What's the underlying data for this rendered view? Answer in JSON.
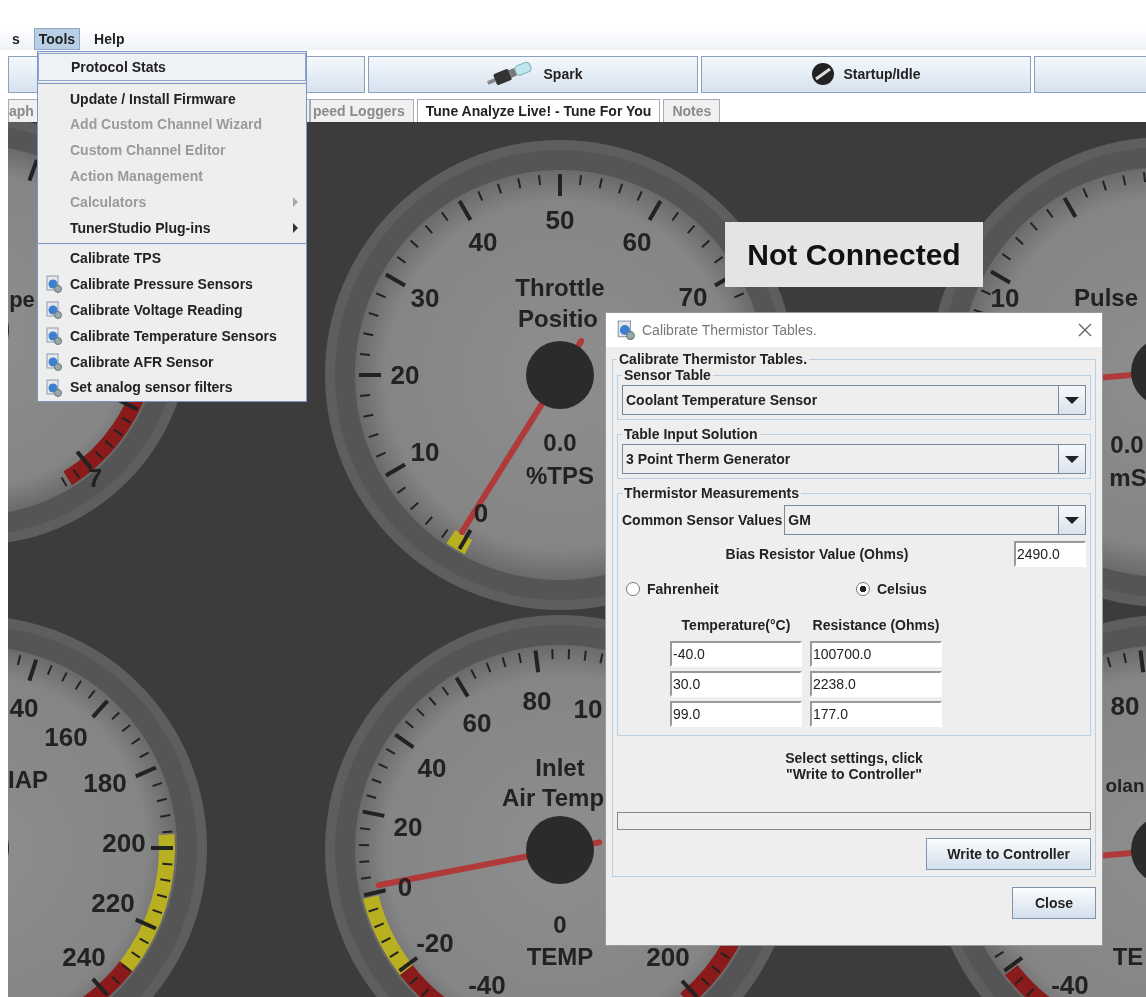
{
  "menubar": {
    "items": [
      {
        "label": "s",
        "selected": false
      },
      {
        "label": "Tools",
        "selected": true
      },
      {
        "label": "Help",
        "selected": false
      }
    ]
  },
  "tools_menu": {
    "items": [
      {
        "kind": "item",
        "label": "Protocol Stats",
        "selected": true,
        "disabled": false,
        "submenu": false,
        "icon": false
      },
      {
        "kind": "separator"
      },
      {
        "kind": "item",
        "label": "Update / Install Firmware",
        "selected": false,
        "disabled": false,
        "submenu": false,
        "icon": false
      },
      {
        "kind": "item",
        "label": "Add Custom Channel Wizard",
        "selected": false,
        "disabled": true,
        "submenu": false,
        "icon": false
      },
      {
        "kind": "item",
        "label": "Custom Channel Editor",
        "selected": false,
        "disabled": true,
        "submenu": false,
        "icon": false
      },
      {
        "kind": "item",
        "label": "Action Management",
        "selected": false,
        "disabled": true,
        "submenu": false,
        "icon": false
      },
      {
        "kind": "item",
        "label": "Calculators",
        "selected": false,
        "disabled": true,
        "submenu": true,
        "icon": false
      },
      {
        "kind": "item",
        "label": "TunerStudio Plug-ins",
        "selected": false,
        "disabled": false,
        "submenu": true,
        "icon": false
      },
      {
        "kind": "separator"
      },
      {
        "kind": "item",
        "label": "Calibrate TPS",
        "selected": false,
        "disabled": false,
        "submenu": false,
        "icon": false
      },
      {
        "kind": "item",
        "label": "Calibrate Pressure Sensors",
        "selected": false,
        "disabled": false,
        "submenu": false,
        "icon": true
      },
      {
        "kind": "item",
        "label": "Calibrate Voltage Reading",
        "selected": false,
        "disabled": false,
        "submenu": false,
        "icon": true
      },
      {
        "kind": "item",
        "label": "Calibrate Temperature Sensors",
        "selected": false,
        "disabled": false,
        "submenu": false,
        "icon": true
      },
      {
        "kind": "item",
        "label": "Calibrate AFR Sensor",
        "selected": false,
        "disabled": false,
        "submenu": false,
        "icon": true
      },
      {
        "kind": "item",
        "label": "Set analog sensor filters",
        "selected": false,
        "disabled": false,
        "submenu": false,
        "icon": true
      }
    ]
  },
  "toolbar": {
    "buttons": [
      {
        "label": "Spark"
      },
      {
        "label": "Startup/Idle"
      }
    ]
  },
  "tabs": [
    {
      "label": "aph",
      "selected": false
    },
    {
      "label": "peed Loggers",
      "selected": false
    },
    {
      "label": "Tune Analyze Live! - Tune For You",
      "selected": true
    },
    {
      "label": "Notes",
      "selected": false
    }
  ],
  "dashboard": {
    "status": "Not Connected",
    "gauges": [
      {
        "title_lines": [
          "pe"
        ],
        "scale_labels": [
          "7"
        ]
      },
      {
        "title_lines": [
          "Throttle",
          "Positio"
        ],
        "value": "0.0",
        "unit": "%TPS",
        "scale_labels": [
          "0",
          "10",
          "20",
          "30",
          "40",
          "50",
          "60",
          "70"
        ]
      },
      {
        "title_lines": [
          "Pulse"
        ],
        "value": "0.0",
        "unit": "mS",
        "scale_labels": [
          "10"
        ]
      },
      {
        "title_lines": [
          "IAP"
        ],
        "scale_labels": [
          "40",
          "160",
          "180",
          "200",
          "220",
          "240"
        ]
      },
      {
        "title_lines": [
          "Inlet",
          "Air Temp"
        ],
        "value": "0",
        "unit": "TEMP",
        "scale_labels": [
          "0",
          "20",
          "40",
          "60",
          "80",
          "10",
          "-20",
          "-40",
          "200"
        ]
      },
      {
        "title_lines": [
          "olan"
        ],
        "unit": "TE",
        "scale_labels": [
          "80",
          "-40"
        ]
      }
    ]
  },
  "dialog": {
    "title": "Calibrate Thermistor Tables.",
    "panel_title": "Calibrate Thermistor Tables.",
    "sensor_table": {
      "label": "Sensor Table",
      "value": "Coolant Temperature Sensor"
    },
    "input_solution": {
      "label": "Table Input Solution",
      "value": "3 Point Therm Generator"
    },
    "measurements": {
      "label": "Thermistor Measurements",
      "common_label": "Common Sensor Values",
      "common_value": "GM",
      "bias_label": "Bias Resistor Value (Ohms)",
      "bias_value": "2490.0",
      "units": [
        {
          "label": "Fahrenheit",
          "selected": false
        },
        {
          "label": "Celsius",
          "selected": true
        }
      ],
      "columns": [
        "Temperature(°C)",
        "Resistance (Ohms)"
      ],
      "rows": [
        [
          "-40.0",
          "100700.0"
        ],
        [
          "30.0",
          "2238.0"
        ],
        [
          "99.0",
          "177.0"
        ]
      ]
    },
    "message": "Select settings, click\n\"Write to Controller\"",
    "progress": {
      "level": 0
    },
    "write_button": "Write to Controller",
    "close_button": "Close"
  }
}
